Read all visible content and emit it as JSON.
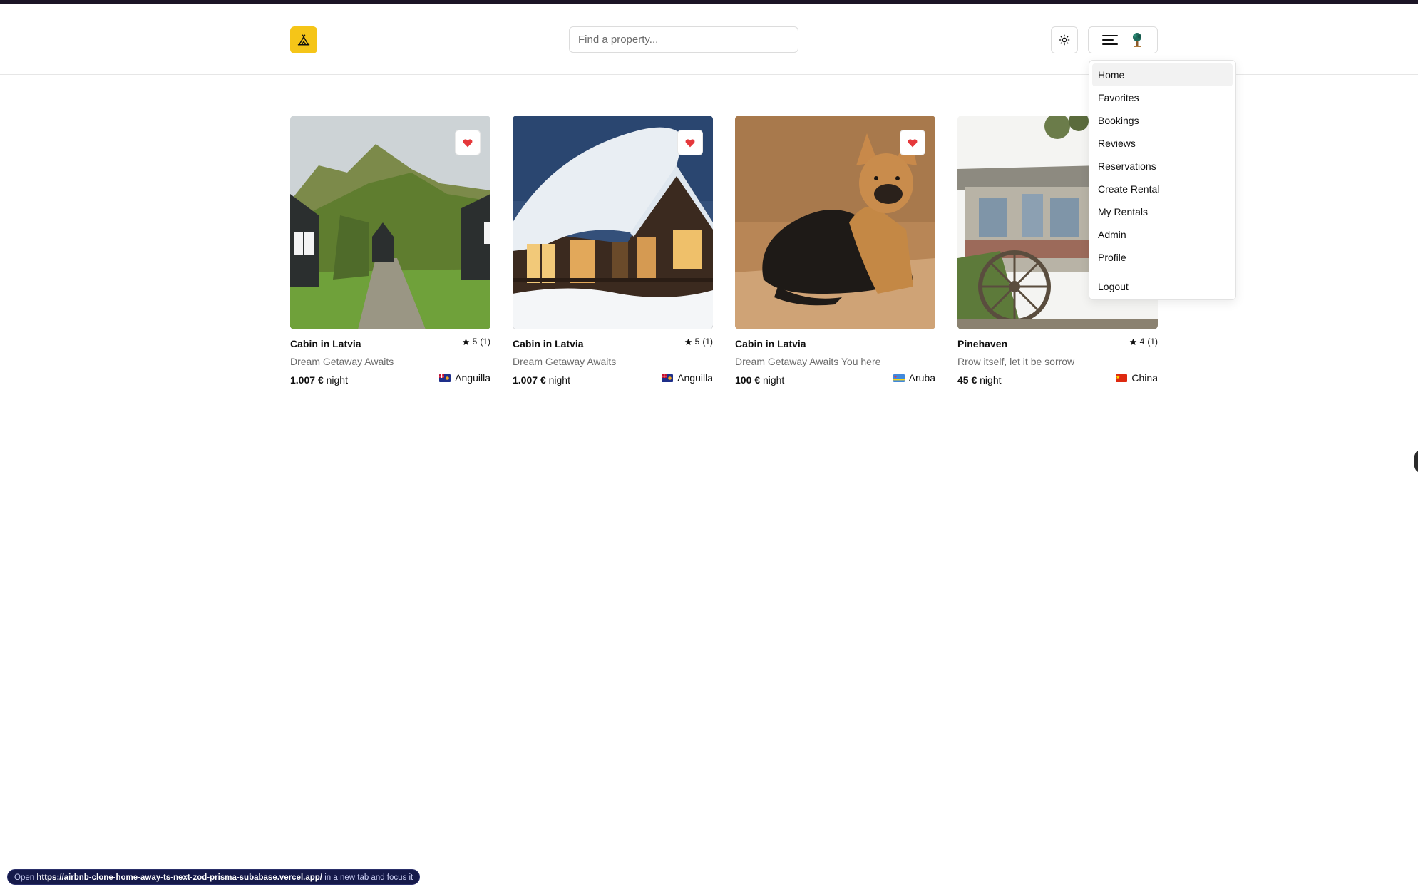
{
  "search": {
    "placeholder": "Find a property..."
  },
  "menu": {
    "items": [
      "Home",
      "Favorites",
      "Bookings",
      "Reviews",
      "Reservations",
      "Create Rental",
      "My Rentals",
      "Admin",
      "Profile"
    ],
    "logout": "Logout",
    "active_item": "Home"
  },
  "properties": [
    {
      "title": "Cabin in Latvia",
      "rating": "5",
      "reviews": "(1)",
      "tagline": "Dream Getaway Awaits",
      "price": "1.007 €",
      "price_unit": "night",
      "country": "Anguilla",
      "favorited": true
    },
    {
      "title": "Cabin in Latvia",
      "rating": "5",
      "reviews": "(1)",
      "tagline": "Dream Getaway Awaits",
      "price": "1.007 €",
      "price_unit": "night",
      "country": "Anguilla",
      "favorited": true
    },
    {
      "title": "Cabin in Latvia",
      "rating": "",
      "reviews": "",
      "tagline": "Dream Getaway Awaits You here",
      "price": "100 €",
      "price_unit": "night",
      "country": "Aruba",
      "favorited": true
    },
    {
      "title": "Pinehaven",
      "rating": "4",
      "reviews": "(1)",
      "tagline": "Rrow itself, let it be sorrow",
      "price": "45 €",
      "price_unit": "night",
      "country": "China",
      "favorited": false
    }
  ],
  "status_bar": {
    "prefix": "Open",
    "url": "https://airbnb-clone-home-away-ts-next-zod-prisma-subabase.vercel.app/",
    "suffix": "in a new tab and focus it"
  },
  "colors": {
    "brand": "#f5c518",
    "heart": "#e5383b",
    "status_bg": "#161a4a"
  },
  "icons": {
    "logo": "tent-icon",
    "theme": "sun-icon",
    "menu": "hamburger-icon",
    "avatar": "user-avatar-icon",
    "favorite": "heart-icon",
    "rating": "star-icon"
  }
}
